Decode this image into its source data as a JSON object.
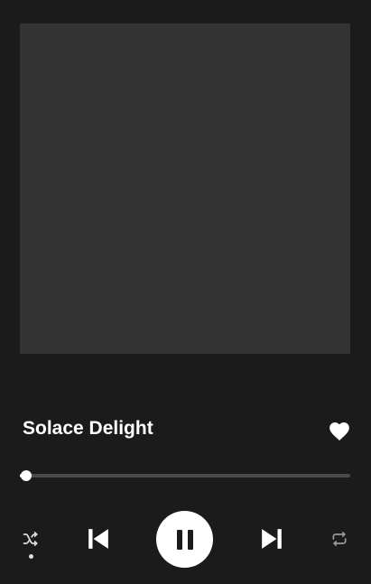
{
  "player": {
    "track_title": "Solace Delight",
    "liked": true,
    "progress_fraction": 0.02,
    "shuffle_active": true,
    "is_playing": true,
    "icons": {
      "like": "heart-icon",
      "shuffle": "shuffle-icon",
      "previous": "skip-previous-icon",
      "play_pause": "pause-icon",
      "next": "skip-next-icon",
      "repeat": "repeat-icon"
    }
  },
  "colors": {
    "background": "#1b1b1b",
    "artwork_placeholder": "#333333",
    "accent": "#ffffff",
    "inactive": "#9a9a9a"
  }
}
